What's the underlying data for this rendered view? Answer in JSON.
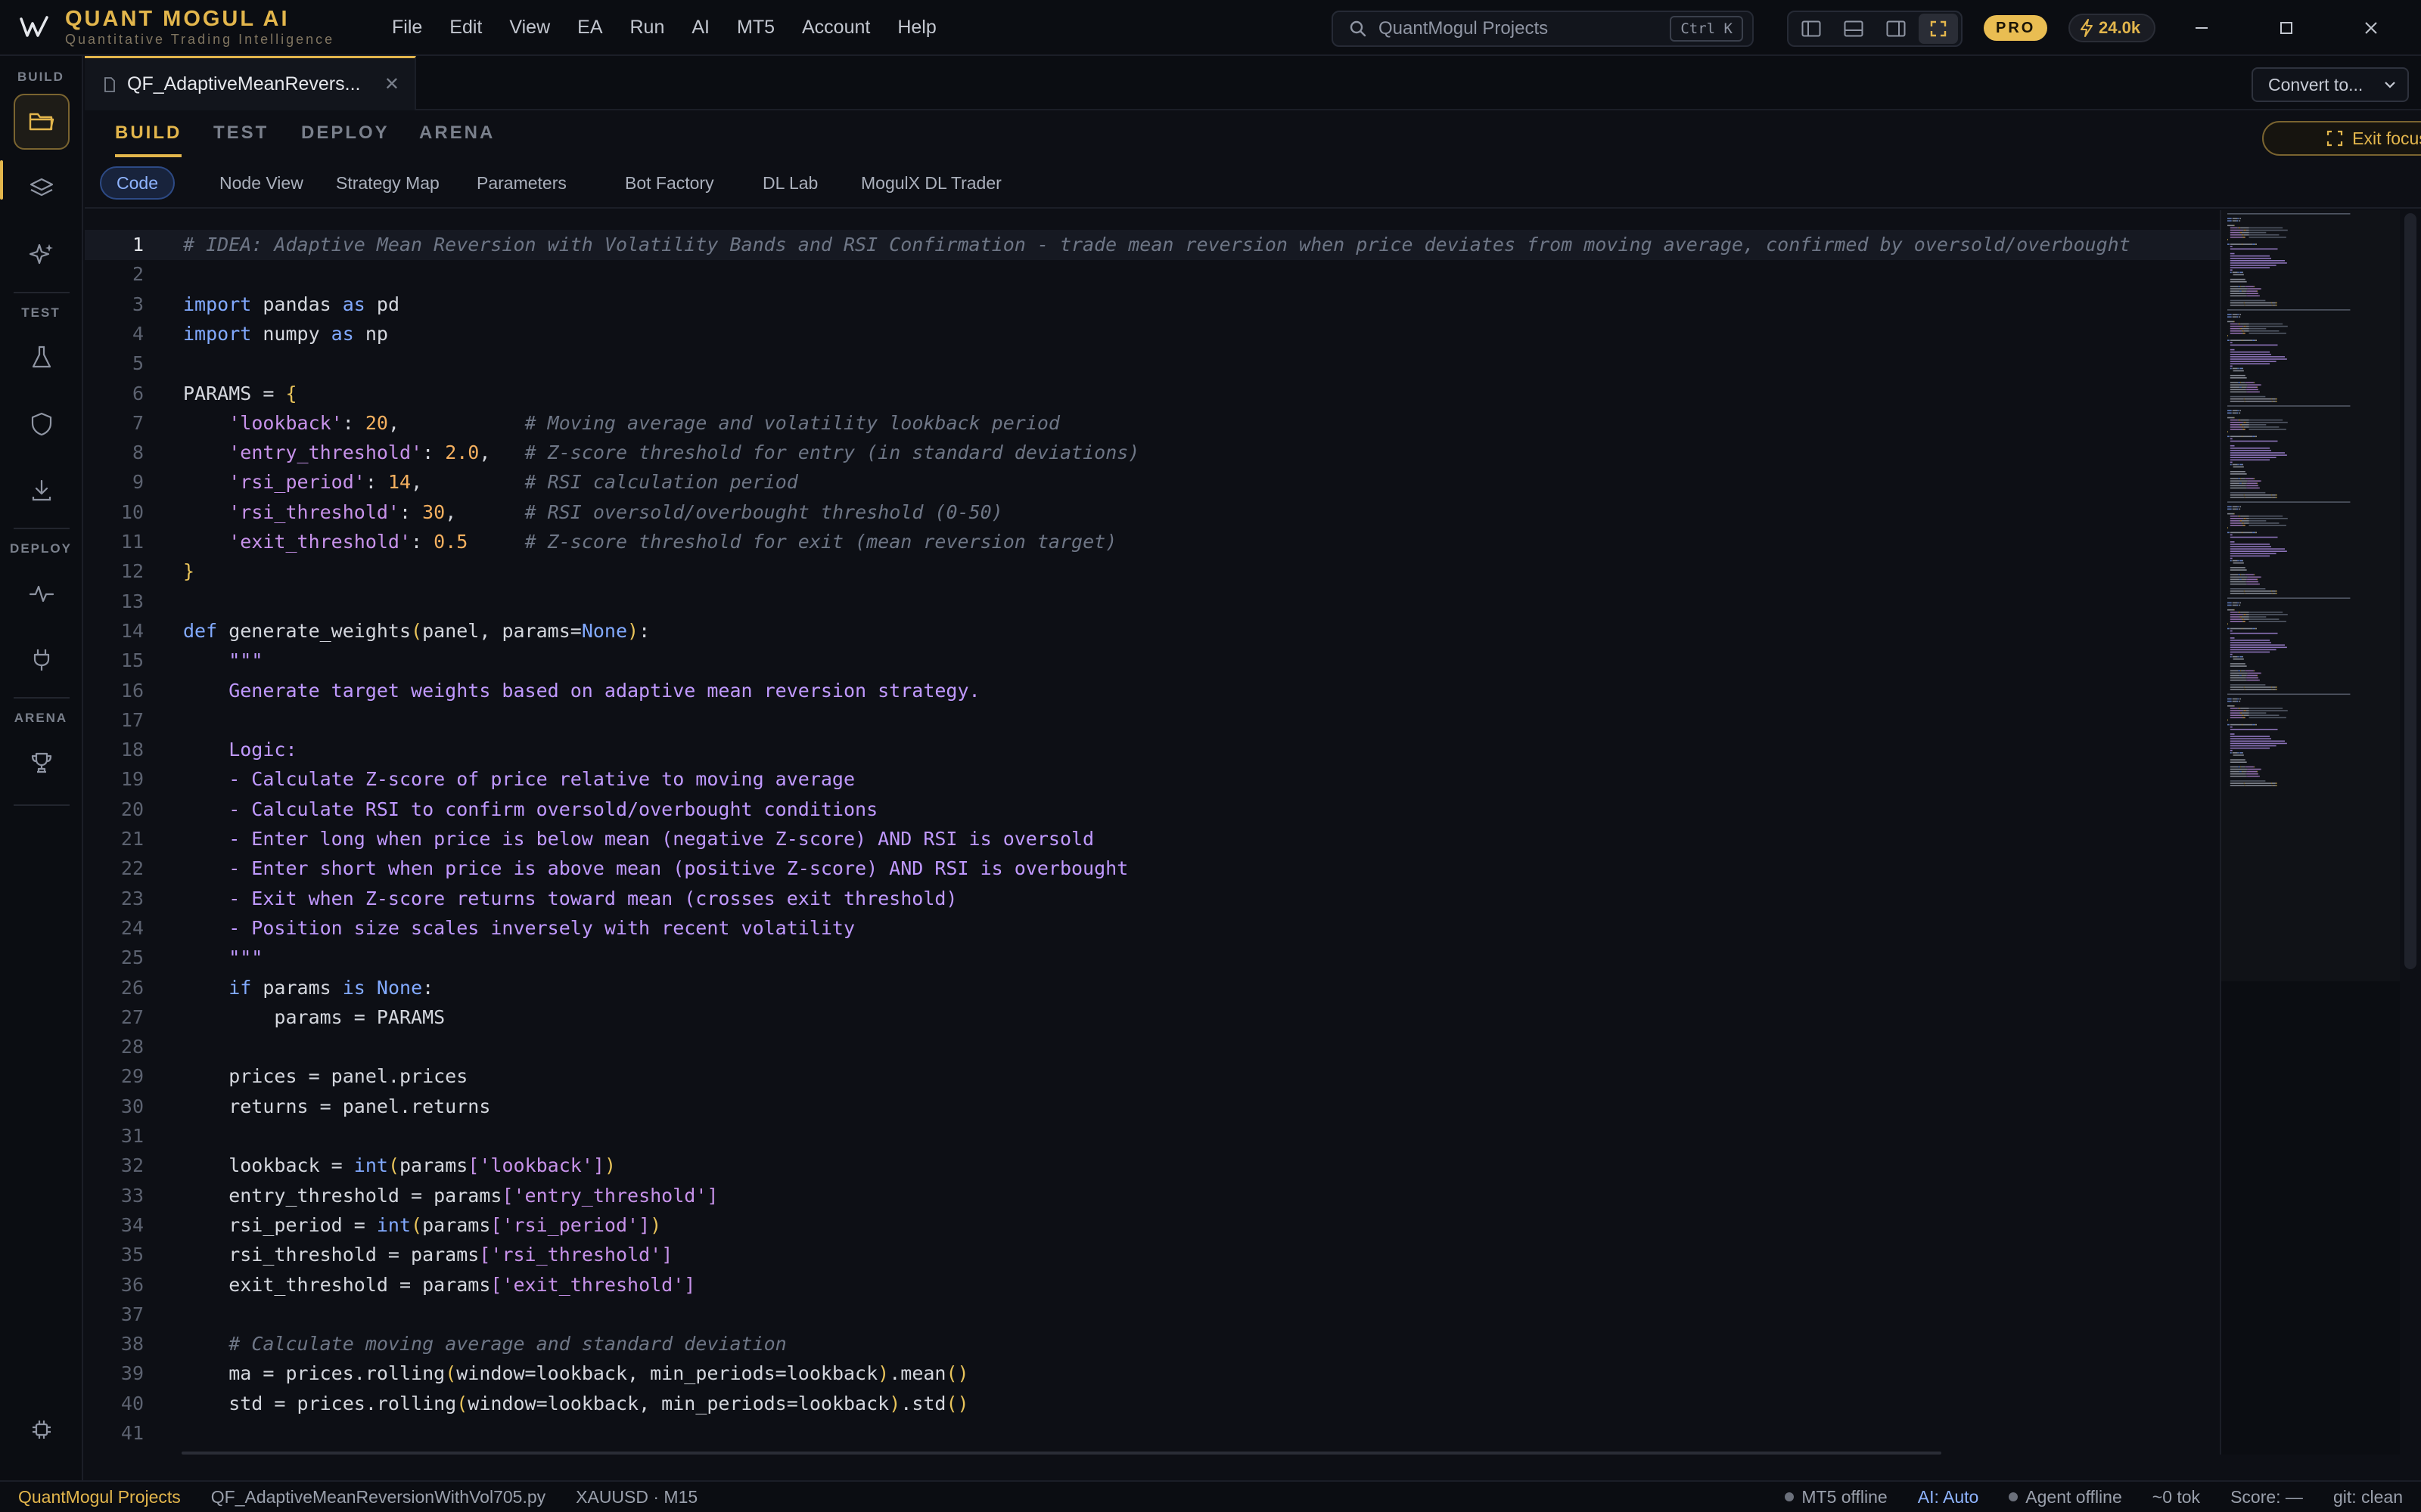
{
  "app": {
    "name": "QUANT MOGUL AI",
    "tagline": "Quantitative Trading Intelligence"
  },
  "menu": [
    "File",
    "Edit",
    "View",
    "EA",
    "Run",
    "AI",
    "MT5",
    "Account",
    "Help"
  ],
  "search": {
    "placeholder": "QuantMogul Projects",
    "shortcut": "Ctrl K"
  },
  "plan_badge": "PRO",
  "credits": "24.0k",
  "activity": {
    "sections": [
      "BUILD",
      "TEST",
      "DEPLOY",
      "ARENA"
    ],
    "icons": [
      "folder-icon",
      "layers-icon",
      "sparkle-icon",
      "flask-icon",
      "shield-icon",
      "download-icon",
      "pulse-icon",
      "plug-icon",
      "trophy-icon",
      "settings-chip-icon"
    ]
  },
  "tab": {
    "label": "QF_AdaptiveMeanRevers..."
  },
  "convert_label": "Convert to...",
  "modes": [
    "BUILD",
    "TEST",
    "DEPLOY",
    "ARENA"
  ],
  "active_mode": "BUILD",
  "exit_focus_label": "Exit focus",
  "subtabs": [
    "Code",
    "Node View",
    "Strategy Map",
    "Parameters",
    "Bot Factory",
    "DL Lab",
    "MogulX DL Trader"
  ],
  "active_subtab": "Code",
  "code_lines": [
    [
      [
        "c",
        "# IDEA: Adaptive Mean Reversion with Volatility Bands and RSI Confirmation - trade mean reversion when price deviates from moving average, confirmed by oversold/overbought"
      ]
    ],
    [],
    [
      [
        "k",
        "import"
      ],
      [
        "p",
        " pandas "
      ],
      [
        "k",
        "as"
      ],
      [
        "p",
        " pd"
      ]
    ],
    [
      [
        "k",
        "import"
      ],
      [
        "p",
        " numpy "
      ],
      [
        "k",
        "as"
      ],
      [
        "p",
        " np"
      ]
    ],
    [],
    [
      [
        "p",
        "PARAMS = "
      ],
      [
        "b",
        "{"
      ]
    ],
    [
      [
        "p",
        "    "
      ],
      [
        "s",
        "'lookback'"
      ],
      [
        "p",
        ": "
      ],
      [
        "n",
        "20"
      ],
      [
        "p",
        ",           "
      ],
      [
        "c",
        "# Moving average and volatility lookback period"
      ]
    ],
    [
      [
        "p",
        "    "
      ],
      [
        "s",
        "'entry_threshold'"
      ],
      [
        "p",
        ": "
      ],
      [
        "n",
        "2.0"
      ],
      [
        "p",
        ",   "
      ],
      [
        "c",
        "# Z-score threshold for entry (in standard deviations)"
      ]
    ],
    [
      [
        "p",
        "    "
      ],
      [
        "s",
        "'rsi_period'"
      ],
      [
        "p",
        ": "
      ],
      [
        "n",
        "14"
      ],
      [
        "p",
        ",         "
      ],
      [
        "c",
        "# RSI calculation period"
      ]
    ],
    [
      [
        "p",
        "    "
      ],
      [
        "s",
        "'rsi_threshold'"
      ],
      [
        "p",
        ": "
      ],
      [
        "n",
        "30"
      ],
      [
        "p",
        ",      "
      ],
      [
        "c",
        "# RSI oversold/overbought threshold (0-50)"
      ]
    ],
    [
      [
        "p",
        "    "
      ],
      [
        "s",
        "'exit_threshold'"
      ],
      [
        "p",
        ": "
      ],
      [
        "n",
        "0.5"
      ],
      [
        "p",
        "     "
      ],
      [
        "c",
        "# Z-score threshold for exit (mean reversion target)"
      ]
    ],
    [
      [
        "b",
        "}"
      ]
    ],
    [],
    [
      [
        "k",
        "def"
      ],
      [
        "p",
        " generate_weights"
      ],
      [
        "b",
        "("
      ],
      [
        "p",
        "panel, params="
      ],
      [
        "k",
        "None"
      ],
      [
        "b",
        ")"
      ],
      [
        "p",
        ":"
      ]
    ],
    [
      [
        "p",
        "    "
      ],
      [
        "d",
        "\"\"\""
      ]
    ],
    [
      [
        "d",
        "    Generate target weights based on adaptive mean reversion strategy."
      ]
    ],
    [],
    [
      [
        "d",
        "    Logic:"
      ]
    ],
    [
      [
        "d",
        "    - Calculate Z-score of price relative to moving average"
      ]
    ],
    [
      [
        "d",
        "    - Calculate RSI to confirm oversold/overbought conditions"
      ]
    ],
    [
      [
        "d",
        "    - Enter long when price is below mean (negative Z-score) AND RSI is oversold"
      ]
    ],
    [
      [
        "d",
        "    - Enter short when price is above mean (positive Z-score) AND RSI is overbought"
      ]
    ],
    [
      [
        "d",
        "    - Exit when Z-score returns toward mean (crosses exit threshold)"
      ]
    ],
    [
      [
        "d",
        "    - Position size scales inversely with recent volatility"
      ]
    ],
    [
      [
        "d",
        "    \"\"\""
      ]
    ],
    [
      [
        "p",
        "    "
      ],
      [
        "k",
        "if"
      ],
      [
        "p",
        " params "
      ],
      [
        "k",
        "is"
      ],
      [
        "p",
        " "
      ],
      [
        "k",
        "None"
      ],
      [
        "p",
        ":"
      ]
    ],
    [
      [
        "p",
        "        params = PARAMS"
      ]
    ],
    [],
    [
      [
        "p",
        "    prices = panel.prices"
      ]
    ],
    [
      [
        "p",
        "    returns = panel.returns"
      ]
    ],
    [],
    [
      [
        "p",
        "    lookback = "
      ],
      [
        "k",
        "int"
      ],
      [
        "b",
        "("
      ],
      [
        "p",
        "params"
      ],
      [
        "s",
        "["
      ],
      [
        "s",
        "'lookback'"
      ],
      [
        "s",
        "]"
      ],
      [
        "b",
        ")"
      ]
    ],
    [
      [
        "p",
        "    entry_threshold = params"
      ],
      [
        "s",
        "["
      ],
      [
        "s",
        "'entry_threshold'"
      ],
      [
        "s",
        "]"
      ]
    ],
    [
      [
        "p",
        "    rsi_period = "
      ],
      [
        "k",
        "int"
      ],
      [
        "b",
        "("
      ],
      [
        "p",
        "params"
      ],
      [
        "s",
        "["
      ],
      [
        "s",
        "'rsi_period'"
      ],
      [
        "s",
        "]"
      ],
      [
        "b",
        ")"
      ]
    ],
    [
      [
        "p",
        "    rsi_threshold = params"
      ],
      [
        "s",
        "["
      ],
      [
        "s",
        "'rsi_threshold'"
      ],
      [
        "s",
        "]"
      ]
    ],
    [
      [
        "p",
        "    exit_threshold = params"
      ],
      [
        "s",
        "["
      ],
      [
        "s",
        "'exit_threshold'"
      ],
      [
        "s",
        "]"
      ]
    ],
    [],
    [
      [
        "p",
        "    "
      ],
      [
        "c",
        "# Calculate moving average and standard deviation"
      ]
    ],
    [
      [
        "p",
        "    ma = prices.rolling"
      ],
      [
        "b",
        "("
      ],
      [
        "p",
        "window=lookback, min_periods=lookback"
      ],
      [
        "b",
        ")"
      ],
      [
        "p",
        ".mean"
      ],
      [
        "b",
        "()"
      ]
    ],
    [
      [
        "p",
        "    std = prices.rolling"
      ],
      [
        "b",
        "("
      ],
      [
        "p",
        "window=lookback, min_periods=lookback"
      ],
      [
        "b",
        ")"
      ],
      [
        "p",
        ".std"
      ],
      [
        "b",
        "()"
      ]
    ],
    []
  ],
  "current_line": 1,
  "status": {
    "project": "QuantMogul Projects",
    "file": "QF_AdaptiveMeanReversionWithVol705.py",
    "symbol": "XAUUSD · M15",
    "mt5": "MT5 offline",
    "ai": "AI: Auto",
    "agent": "Agent offline",
    "tokens": "~0 tok",
    "score": "Score: —",
    "git": "git: clean"
  },
  "colors": {
    "accent": "#e3b64c",
    "keyword": "#82aaff",
    "string": "#c792ea",
    "number": "#f4b05f",
    "comment": "#6e7686",
    "docstring": "#c099ff",
    "active_subtab": "#8fb4ff"
  }
}
